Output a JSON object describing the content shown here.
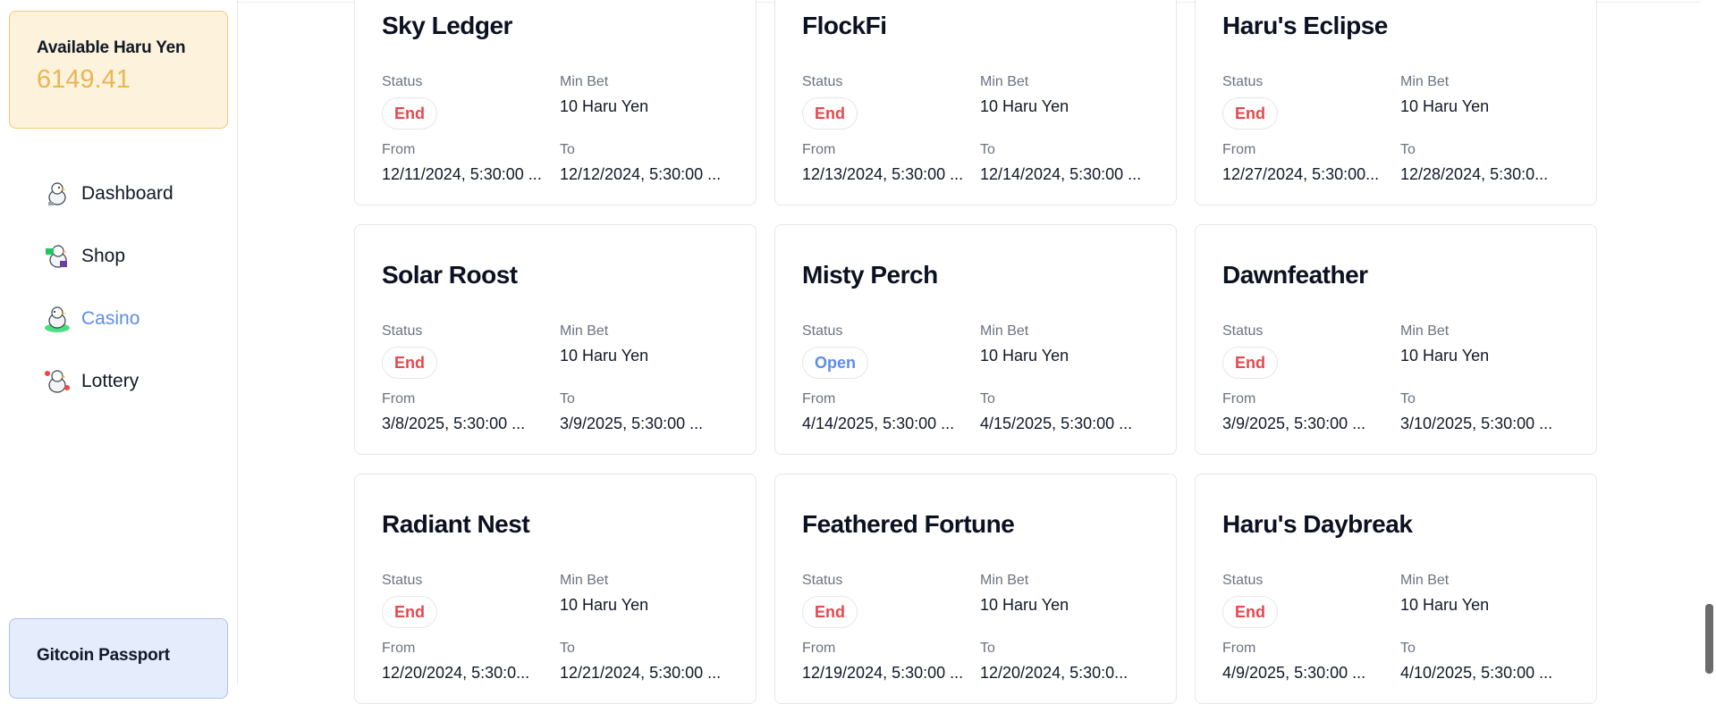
{
  "sidebar": {
    "balance_label": "Available Haru Yen",
    "balance_value": "6149.41",
    "items": [
      {
        "label": "Dashboard",
        "icon": "duck-dashboard-icon"
      },
      {
        "label": "Shop",
        "icon": "duck-shop-icon"
      },
      {
        "label": "Casino",
        "icon": "duck-casino-icon",
        "active": true
      },
      {
        "label": "Lottery",
        "icon": "duck-lottery-icon"
      }
    ],
    "passport_label": "Gitcoin Passport"
  },
  "field_labels": {
    "status": "Status",
    "min_bet": "Min Bet",
    "from": "From",
    "to": "To"
  },
  "cards": [
    {
      "title": "Sky Ledger",
      "status": "End",
      "min_bet": "10 Haru Yen",
      "from": "12/11/2024, 5:30:00 ...",
      "to": "12/12/2024, 5:30:00 ..."
    },
    {
      "title": "FlockFi",
      "status": "End",
      "min_bet": "10 Haru Yen",
      "from": "12/13/2024, 5:30:00 ...",
      "to": "12/14/2024, 5:30:00 ..."
    },
    {
      "title": "Haru's Eclipse",
      "status": "End",
      "min_bet": "10 Haru Yen",
      "from": "12/27/2024, 5:30:00...",
      "to": "12/28/2024, 5:30:0..."
    },
    {
      "title": "Solar Roost",
      "status": "End",
      "min_bet": "10 Haru Yen",
      "from": "3/8/2025, 5:30:00 ...",
      "to": "3/9/2025, 5:30:00 ..."
    },
    {
      "title": "Misty Perch",
      "status": "Open",
      "min_bet": "10 Haru Yen",
      "from": "4/14/2025, 5:30:00 ...",
      "to": "4/15/2025, 5:30:00 ..."
    },
    {
      "title": "Dawnfeather",
      "status": "End",
      "min_bet": "10 Haru Yen",
      "from": "3/9/2025, 5:30:00 ...",
      "to": "3/10/2025, 5:30:00 ..."
    },
    {
      "title": "Radiant Nest",
      "status": "End",
      "min_bet": "10 Haru Yen",
      "from": "12/20/2024, 5:30:0...",
      "to": "12/21/2024, 5:30:00 ..."
    },
    {
      "title": "Feathered Fortune",
      "status": "End",
      "min_bet": "10 Haru Yen",
      "from": "12/19/2024, 5:30:00 ...",
      "to": "12/20/2024, 5:30:0..."
    },
    {
      "title": "Haru's Daybreak",
      "status": "End",
      "min_bet": "10 Haru Yen",
      "from": "4/9/2025, 5:30:00 ...",
      "to": "4/10/2025, 5:30:00 ..."
    }
  ],
  "colors": {
    "end": "#e5484d",
    "open": "#5b8ee6",
    "active_nav": "#5b8ee6",
    "balance_accent": "#e9b652"
  }
}
